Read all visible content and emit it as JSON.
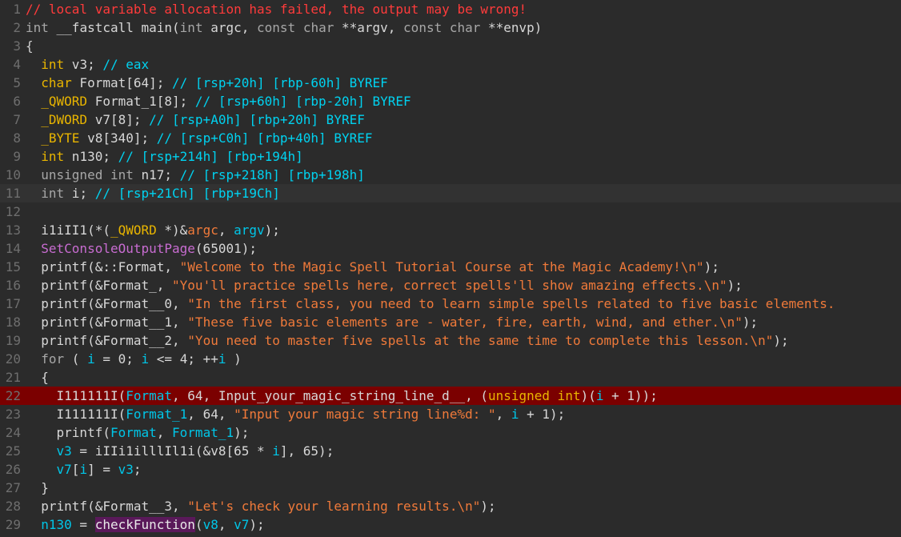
{
  "lines": [
    {
      "n": "1",
      "tokens": [
        [
          "t-warn",
          "// local variable allocation has failed, the output may be wrong!"
        ]
      ]
    },
    {
      "n": "2",
      "tokens": [
        [
          "t-kw",
          "int"
        ],
        [
          "t-ident",
          " __fastcall main("
        ],
        [
          "t-kw",
          "int"
        ],
        [
          "t-ident",
          " argc, "
        ],
        [
          "t-kw",
          "const char"
        ],
        [
          "t-ident",
          " **argv, "
        ],
        [
          "t-kw",
          "const char"
        ],
        [
          "t-ident",
          " **envp)"
        ]
      ]
    },
    {
      "n": "3",
      "tokens": [
        [
          "t-punc",
          "{"
        ]
      ]
    },
    {
      "n": "4",
      "tokens": [
        [
          "t-type",
          "  int"
        ],
        [
          "t-ident",
          " v3; "
        ],
        [
          "t-comment",
          "// eax"
        ]
      ]
    },
    {
      "n": "5",
      "tokens": [
        [
          "t-type",
          "  char"
        ],
        [
          "t-ident",
          " Format[64]; "
        ],
        [
          "t-comment",
          "// [rsp+20h] [rbp-60h] BYREF"
        ]
      ]
    },
    {
      "n": "6",
      "tokens": [
        [
          "t-type",
          "  _QWORD"
        ],
        [
          "t-ident",
          " Format_1[8]; "
        ],
        [
          "t-comment",
          "// [rsp+60h] [rbp-20h] BYREF"
        ]
      ]
    },
    {
      "n": "7",
      "tokens": [
        [
          "t-type",
          "  _DWORD"
        ],
        [
          "t-ident",
          " v7[8]; "
        ],
        [
          "t-comment",
          "// [rsp+A0h] [rbp+20h] BYREF"
        ]
      ]
    },
    {
      "n": "8",
      "tokens": [
        [
          "t-type",
          "  _BYTE"
        ],
        [
          "t-ident",
          " v8[340]; "
        ],
        [
          "t-comment",
          "// [rsp+C0h] [rbp+40h] BYREF"
        ]
      ]
    },
    {
      "n": "9",
      "tokens": [
        [
          "t-type",
          "  int"
        ],
        [
          "t-ident",
          " n130; "
        ],
        [
          "t-comment",
          "// [rsp+214h] [rbp+194h]"
        ]
      ]
    },
    {
      "n": "10",
      "tokens": [
        [
          "t-kw",
          "  unsigned int"
        ],
        [
          "t-ident",
          " n17; "
        ],
        [
          "t-comment",
          "// [rsp+218h] [rbp+198h]"
        ]
      ]
    },
    {
      "n": "11",
      "tokens": [
        [
          "t-kw",
          "  int"
        ],
        [
          "t-ident",
          " i; "
        ],
        [
          "t-comment",
          "// [rsp+21Ch] [rbp+19Ch]"
        ]
      ]
    },
    {
      "n": "12",
      "tokens": []
    },
    {
      "n": "13",
      "tokens": [
        [
          "t-ident",
          "  i1iII1(*("
        ],
        [
          "t-type",
          "_QWORD"
        ],
        [
          "t-ident",
          " *)&"
        ],
        [
          "t-param",
          "argc"
        ],
        [
          "t-ident",
          ", "
        ],
        [
          "t-local",
          "argv"
        ],
        [
          "t-ident",
          ");"
        ]
      ]
    },
    {
      "n": "14",
      "tokens": [
        [
          "t-func",
          "  SetConsoleOutputPage"
        ],
        [
          "t-ident",
          "(65001);"
        ]
      ]
    },
    {
      "n": "15",
      "tokens": [
        [
          "t-ident",
          "  printf(&::Format, "
        ],
        [
          "t-str",
          "\"Welcome to the Magic Spell Tutorial Course at the Magic Academy!\\n\""
        ],
        [
          "t-ident",
          ");"
        ]
      ]
    },
    {
      "n": "16",
      "tokens": [
        [
          "t-ident",
          "  printf(&Format_, "
        ],
        [
          "t-str",
          "\"You'll practice spells here, correct spells'll show amazing effects.\\n\""
        ],
        [
          "t-ident",
          ");"
        ]
      ]
    },
    {
      "n": "17",
      "tokens": [
        [
          "t-ident",
          "  printf(&Format__0, "
        ],
        [
          "t-str",
          "\"In the first class, you need to learn simple spells related to five basic elements."
        ]
      ]
    },
    {
      "n": "18",
      "tokens": [
        [
          "t-ident",
          "  printf(&Format__1, "
        ],
        [
          "t-str",
          "\"These five basic elements are - water, fire, earth, wind, and ether.\\n\""
        ],
        [
          "t-ident",
          ");"
        ]
      ]
    },
    {
      "n": "19",
      "tokens": [
        [
          "t-ident",
          "  printf(&Format__2, "
        ],
        [
          "t-str",
          "\"You need to master five spells at the same time to complete this lesson.\\n\""
        ],
        [
          "t-ident",
          ");"
        ]
      ]
    },
    {
      "n": "20",
      "tokens": [
        [
          "t-kw",
          "  for"
        ],
        [
          "t-ident",
          " ( "
        ],
        [
          "t-local",
          "i"
        ],
        [
          "t-ident",
          " = 0; "
        ],
        [
          "t-local",
          "i"
        ],
        [
          "t-ident",
          " <= 4; ++"
        ],
        [
          "t-local",
          "i"
        ],
        [
          "t-ident",
          " )"
        ]
      ]
    },
    {
      "n": "21",
      "tokens": [
        [
          "t-ident",
          "  {"
        ]
      ]
    },
    {
      "n": "22",
      "hl": true,
      "tokens": [
        [
          "t-ident",
          "    I111111I("
        ],
        [
          "t-local",
          "Format"
        ],
        [
          "t-ident",
          ", 64, Input_your_magic_string_line_d__, ("
        ],
        [
          "t-type",
          "unsigned int"
        ],
        [
          "t-ident",
          ")("
        ],
        [
          "t-local",
          "i"
        ],
        [
          "t-ident",
          " + 1));"
        ]
      ]
    },
    {
      "n": "23",
      "tokens": [
        [
          "t-ident",
          "    I111111I("
        ],
        [
          "t-local",
          "Format_1"
        ],
        [
          "t-ident",
          ", 64, "
        ],
        [
          "t-str",
          "\"Input your magic string line%d: \""
        ],
        [
          "t-ident",
          ", "
        ],
        [
          "t-local",
          "i"
        ],
        [
          "t-ident",
          " + 1);"
        ]
      ]
    },
    {
      "n": "24",
      "tokens": [
        [
          "t-ident",
          "    printf("
        ],
        [
          "t-local",
          "Format"
        ],
        [
          "t-ident",
          ", "
        ],
        [
          "t-local",
          "Format_1"
        ],
        [
          "t-ident",
          ");"
        ]
      ]
    },
    {
      "n": "25",
      "tokens": [
        [
          "t-local",
          "    v3"
        ],
        [
          "t-ident",
          " = iIIi1illlIl1i(&v8[65 * "
        ],
        [
          "t-local",
          "i"
        ],
        [
          "t-ident",
          "], 65);"
        ]
      ]
    },
    {
      "n": "26",
      "tokens": [
        [
          "t-local",
          "    v7"
        ],
        [
          "t-ident",
          "["
        ],
        [
          "t-local",
          "i"
        ],
        [
          "t-ident",
          "] = "
        ],
        [
          "t-local",
          "v3"
        ],
        [
          "t-ident",
          ";"
        ]
      ]
    },
    {
      "n": "27",
      "tokens": [
        [
          "t-ident",
          "  }"
        ]
      ]
    },
    {
      "n": "28",
      "tokens": [
        [
          "t-ident",
          "  printf(&Format__3, "
        ],
        [
          "t-str",
          "\"Let's check your learning results.\\n\""
        ],
        [
          "t-ident",
          ");"
        ]
      ]
    },
    {
      "n": "29",
      "tokens": [
        [
          "t-local",
          "  n130"
        ],
        [
          "t-ident",
          " = "
        ],
        [
          "t-hl",
          "checkFunction"
        ],
        [
          "t-ident",
          "("
        ],
        [
          "t-local",
          "v8"
        ],
        [
          "t-ident",
          ", "
        ],
        [
          "t-local",
          "v7"
        ],
        [
          "t-ident",
          ");"
        ]
      ]
    }
  ]
}
